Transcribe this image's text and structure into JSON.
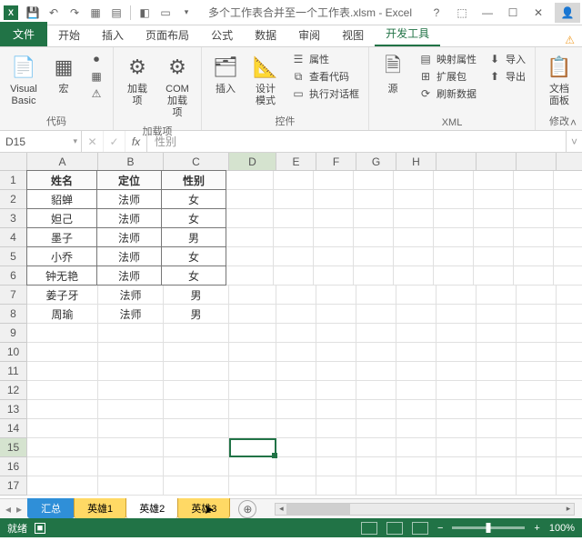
{
  "title": "多个工作表合并至一个工作表.xlsm - Excel",
  "qat": {
    "save": "💾",
    "undo": "↶",
    "redo": "↷"
  },
  "tabs": {
    "file": "文件",
    "home": "开始",
    "insert": "插入",
    "layout": "页面布局",
    "formula": "公式",
    "data": "数据",
    "review": "审阅",
    "view": "视图",
    "dev": "开发工具"
  },
  "ribbon": {
    "vb": "Visual Basic",
    "macro": "宏",
    "group_code": "代码",
    "addins": "加载项",
    "com": "COM 加载项",
    "group_addins": "加载项",
    "insert": "插入",
    "design": "设计模式",
    "props": "属性",
    "viewcode": "查看代码",
    "rundlg": "执行对话框",
    "group_ctrl": "控件",
    "source": "源",
    "mapprop": "映射属性",
    "expand": "扩展包",
    "refresh": "刷新数据",
    "import": "导入",
    "export": "导出",
    "group_xml": "XML",
    "docpanel": "文档面板",
    "group_mod": "修改"
  },
  "namebox": "D15",
  "formula_ghost": "性别",
  "cols": [
    "A",
    "B",
    "C",
    "D",
    "E",
    "F",
    "G",
    "H"
  ],
  "rows_count": 17,
  "active_row": 15,
  "headers": {
    "A": "姓名",
    "B": "定位",
    "C": "性别"
  },
  "data_rows": [
    {
      "A": "貂蝉",
      "B": "法师",
      "C": "女"
    },
    {
      "A": "妲己",
      "B": "法师",
      "C": "女"
    },
    {
      "A": "墨子",
      "B": "法师",
      "C": "男"
    },
    {
      "A": "小乔",
      "B": "法师",
      "C": "女"
    },
    {
      "A": "钟无艳",
      "B": "法师",
      "C": "女"
    },
    {
      "A": "姜子牙",
      "B": "法师",
      "C": "男"
    },
    {
      "A": "周瑜",
      "B": "法师",
      "C": "男"
    }
  ],
  "sheet_tabs": [
    {
      "name": "汇总",
      "color": "blue"
    },
    {
      "name": "英雄1",
      "color": "yellow"
    },
    {
      "name": "英雄2",
      "color": "yellow",
      "active": true
    },
    {
      "name": "英雄3",
      "color": "yellow"
    }
  ],
  "status": {
    "ready": "就绪",
    "record": "■",
    "zoom": "100%"
  }
}
